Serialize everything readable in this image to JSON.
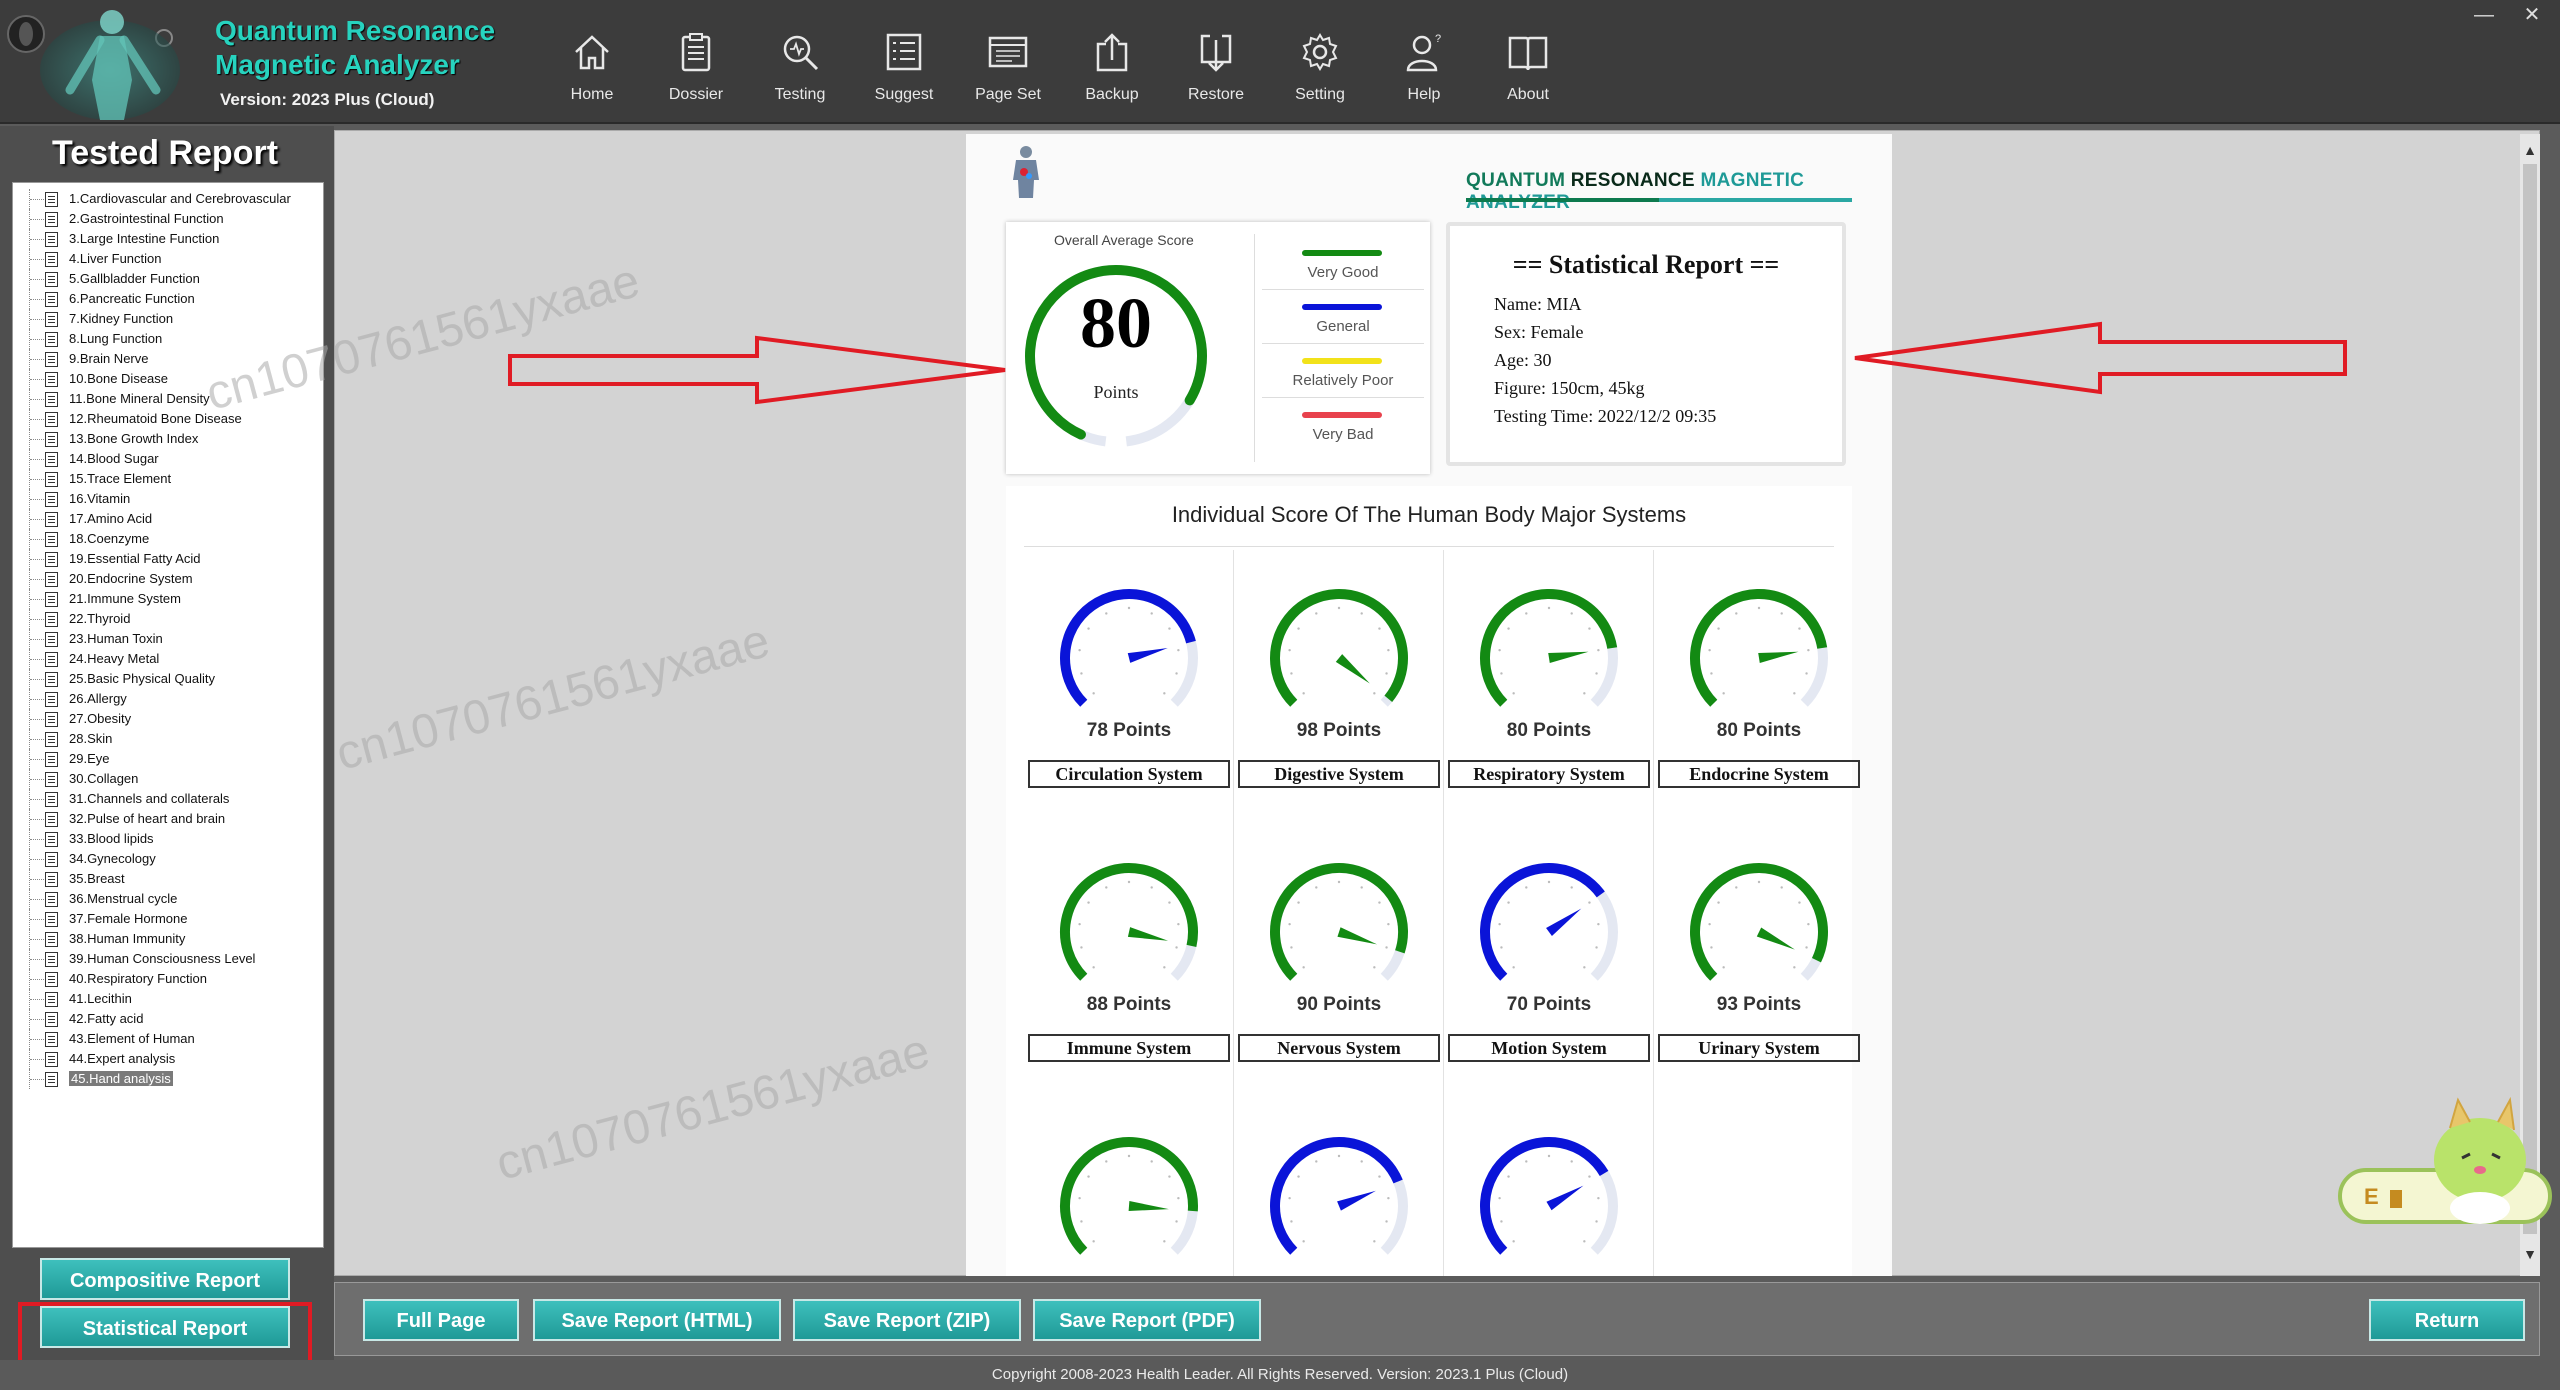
{
  "app": {
    "title_line1": "Quantum Resonance",
    "title_line2": "Magnetic Analyzer",
    "version": "Version: 2023 Plus (Cloud)"
  },
  "window_controls": {
    "minimize": "—",
    "close": "✕"
  },
  "toolbar": [
    {
      "label": "Home",
      "icon": "home-icon"
    },
    {
      "label": "Dossier",
      "icon": "clipboard-icon"
    },
    {
      "label": "Testing",
      "icon": "magnifier-icon"
    },
    {
      "label": "Suggest",
      "icon": "list-icon"
    },
    {
      "label": "Page Set",
      "icon": "page-set-icon"
    },
    {
      "label": "Backup",
      "icon": "upload-icon"
    },
    {
      "label": "Restore",
      "icon": "download-icon"
    },
    {
      "label": "Setting",
      "icon": "gear-icon"
    },
    {
      "label": "Help",
      "icon": "user-help-icon"
    },
    {
      "label": "About",
      "icon": "book-icon"
    }
  ],
  "sidebar": {
    "title": "Tested Report",
    "items": [
      "1.Cardiovascular and Cerebrovascular",
      "2.Gastrointestinal Function",
      "3.Large Intestine Function",
      "4.Liver Function",
      "5.Gallbladder Function",
      "6.Pancreatic Function",
      "7.Kidney Function",
      "8.Lung Function",
      "9.Brain Nerve",
      "10.Bone Disease",
      "11.Bone Mineral Density",
      "12.Rheumatoid Bone Disease",
      "13.Bone Growth Index",
      "14.Blood Sugar",
      "15.Trace Element",
      "16.Vitamin",
      "17.Amino Acid",
      "18.Coenzyme",
      "19.Essential Fatty Acid",
      "20.Endocrine System",
      "21.Immune System",
      "22.Thyroid",
      "23.Human Toxin",
      "24.Heavy Metal",
      "25.Basic Physical Quality",
      "26.Allergy",
      "27.Obesity",
      "28.Skin",
      "29.Eye",
      "30.Collagen",
      "31.Channels and collaterals",
      "32.Pulse of heart and brain",
      "33.Blood lipids",
      "34.Gynecology",
      "35.Breast",
      "36.Menstrual cycle",
      "37.Female Hormone",
      "38.Human Immunity",
      "39.Human Consciousness Level",
      "40.Respiratory Function",
      "41.Lecithin",
      "42.Fatty acid",
      "43.Element of Human",
      "44.Expert analysis",
      "45.Hand analysis"
    ],
    "selected_index": 44,
    "compositive_btn": "Compositive Report",
    "statistical_btn": "Statistical Report"
  },
  "report": {
    "brand_part1": "QUANTUM ",
    "brand_part2": "RESONANCE ",
    "brand_part3": "MAGNETIC ",
    "brand_part4": "ANALYZER",
    "overall_caption": "Overall Average Score",
    "overall_score": "80",
    "overall_unit": "Points",
    "overall_fraction": 0.8,
    "legend": [
      {
        "label": "Very Good",
        "color": "#138a13"
      },
      {
        "label": "General",
        "color": "#0a14d8"
      },
      {
        "label": "Relatively Poor",
        "color": "#f2e21a"
      },
      {
        "label": "Very Bad",
        "color": "#e8424d"
      }
    ],
    "stat": {
      "title": "== Statistical Report ==",
      "name": "Name: MIA",
      "sex": "Sex: Female",
      "age": "Age: 30",
      "figure": "Figure: 150cm, 45kg",
      "testing_time": "Testing Time: 2022/12/2 09:35"
    },
    "systems_title": "Individual Score Of The Human Body Major Systems",
    "systems": [
      {
        "name": "Circulation System",
        "points": "78 Points",
        "score": 78,
        "color": "#0a14d8"
      },
      {
        "name": "Digestive System",
        "points": "98 Points",
        "score": 98,
        "color": "#138a13"
      },
      {
        "name": "Respiratory System",
        "points": "80 Points",
        "score": 80,
        "color": "#138a13"
      },
      {
        "name": "Endocrine System",
        "points": "80 Points",
        "score": 80,
        "color": "#138a13"
      },
      {
        "name": "Immune System",
        "points": "88 Points",
        "score": 88,
        "color": "#138a13"
      },
      {
        "name": "Nervous System",
        "points": "90 Points",
        "score": 90,
        "color": "#138a13"
      },
      {
        "name": "Motion System",
        "points": "70 Points",
        "score": 70,
        "color": "#0a14d8"
      },
      {
        "name": "Urinary System",
        "points": "93 Points",
        "score": 93,
        "color": "#138a13"
      },
      {
        "name": "",
        "points": "",
        "score": 85,
        "color": "#138a13"
      },
      {
        "name": "",
        "points": "",
        "score": 75,
        "color": "#0a14d8"
      },
      {
        "name": "",
        "points": "",
        "score": 72,
        "color": "#0a14d8"
      }
    ]
  },
  "bottom": {
    "full_page": "Full Page",
    "save_html": "Save Report (HTML)",
    "save_zip": "Save Report (ZIP)",
    "save_pdf": "Save Report (PDF)",
    "return": "Return"
  },
  "footer": "Copyright 2008-2023 Health Leader. All Rights Reserved.  Version: 2023.1 Plus (Cloud)",
  "watermark": "cn1070761561yxaae",
  "colors": {
    "accent": "#27d3bf",
    "button": "#2aaeab",
    "annotation": "#e01b24"
  }
}
